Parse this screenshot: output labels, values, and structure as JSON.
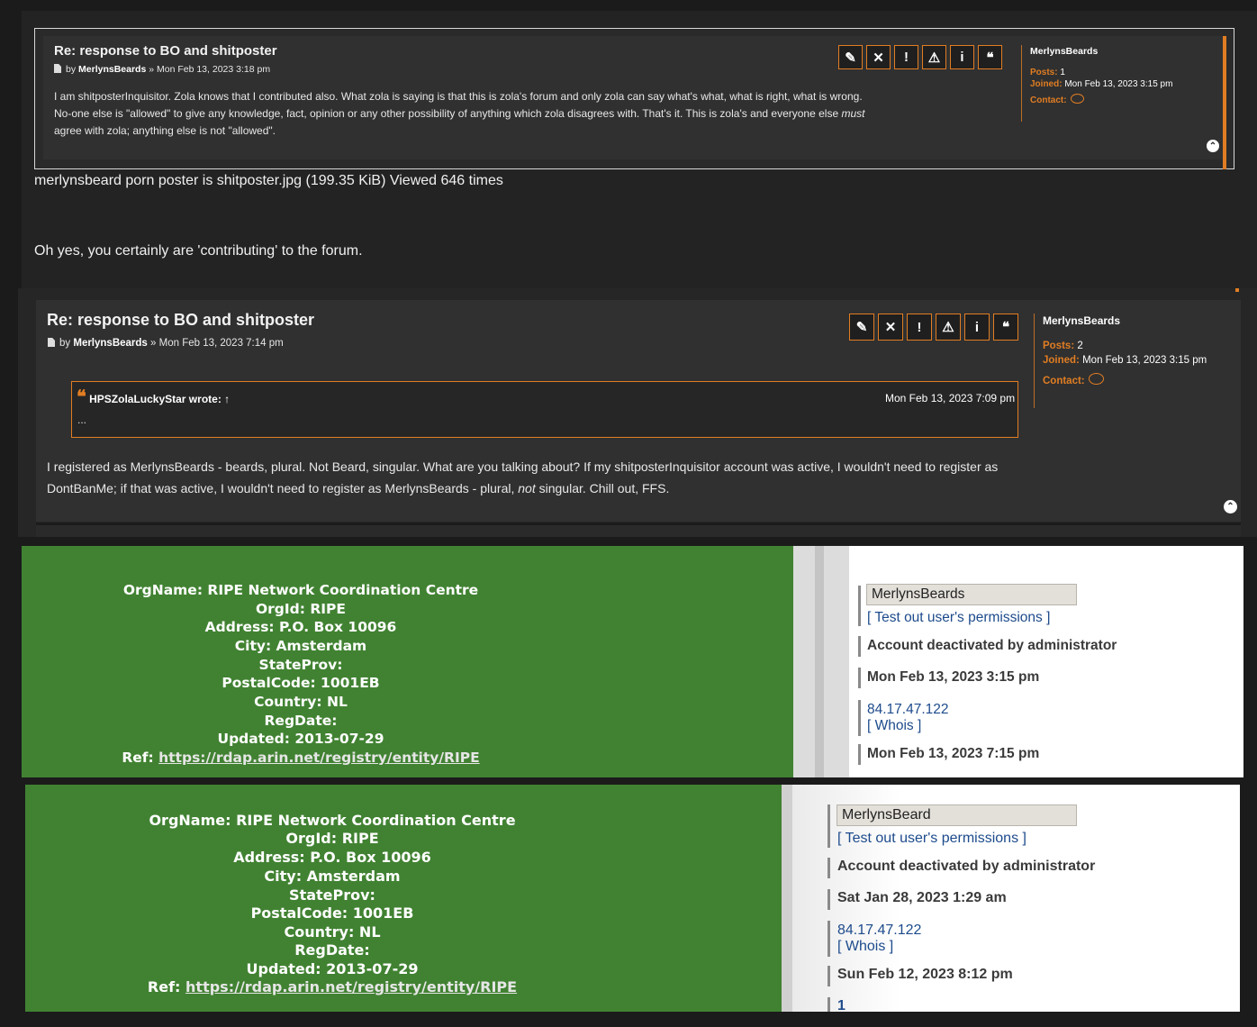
{
  "post1": {
    "title": "Re: response to BO and shitposter",
    "meta_by": "by",
    "author": "MerlynsBeards",
    "meta_date": "» Mon Feb 13, 2023 3:18 pm",
    "body_line1": "I am shitposterInquisitor. Zola knows that I contributed also. What zola is saying is that this is zola's forum and only zola can say what's what, what is right, what is wrong.",
    "body_line2_a": "No-one else is \"allowed\" to give any knowledge, fact, opinion or any other possibility of anything which zola disagrees with. That's it. This is zola's and everyone else ",
    "body_line2_em": "must",
    "body_line3": "agree with zola; anything else is not \"allowed\".",
    "profile": {
      "name": "MerlynsBeards",
      "posts_label": "Posts:",
      "posts_value": "1",
      "joined_label": "Joined:",
      "joined_value": "Mon Feb 13, 2023 3:15 pm",
      "contact_label": "Contact:"
    }
  },
  "buttons": [
    {
      "icon": "pencil-icon",
      "glyph": "✎"
    },
    {
      "icon": "close-icon",
      "glyph": "✕"
    },
    {
      "icon": "exclamation-icon",
      "glyph": "!"
    },
    {
      "icon": "warning-icon",
      "glyph": "⚠"
    },
    {
      "icon": "info-icon",
      "glyph": "i"
    },
    {
      "icon": "quote-icon",
      "glyph": "❝"
    }
  ],
  "attachment_caption": "merlynsbeard porn poster is shitposter.jpg (199.35 KiB) Viewed 646 times",
  "reply_text": "Oh yes, you certainly are 'contributing' to the forum.",
  "post2": {
    "title": "Re: response to BO and shitposter",
    "meta_by": "by",
    "author": "MerlynsBeards",
    "meta_date": "» Mon Feb 13, 2023 7:14 pm",
    "quote_author": "HPSZolaLuckyStar wrote: ↑",
    "quote_date": "Mon Feb 13, 2023 7:09 pm",
    "quote_body": "...",
    "body_line1": "I registered as MerlynsBeards - beards, plural. Not Beard, singular. What are you talking about? If my shitposterInquisitor account was active, I wouldn't need to register as",
    "body_line2_a": "DontBanMe; if that was active, I wouldn't need to register as MerlynsBeards - plural, ",
    "body_line2_em": "not",
    "body_line2_b": " singular. Chill out, FFS.",
    "profile": {
      "name": "MerlynsBeards",
      "posts_label": "Posts:",
      "posts_value": "2",
      "joined_label": "Joined:",
      "joined_value": "Mon Feb 13, 2023 3:15 pm",
      "contact_label": "Contact:"
    }
  },
  "whois1": {
    "lines": [
      "OrgName: RIPE Network Coordination Centre",
      "OrgId: RIPE",
      "Address: P.O. Box 10096",
      "City: Amsterdam",
      "StateProv:",
      "PostalCode: 1001EB",
      "Country: NL",
      "RegDate:",
      "Updated: 2013-07-29"
    ],
    "ref_label": "Ref:",
    "ref_link": "https://rdap.arin.net/registry/entity/RIPE"
  },
  "admin1": {
    "username": "MerlynsBeards",
    "permissions_link": "[ Test out user's permissions ]",
    "status": "Account deactivated by administrator",
    "registered": "Mon Feb 13, 2023 3:15 pm",
    "ip": "84.17.47.122",
    "whois_link": "[ Whois ]",
    "last_active": "Mon Feb 13, 2023 7:15 pm"
  },
  "whois2": {
    "lines": [
      "OrgName: RIPE Network Coordination Centre",
      "OrgId: RIPE",
      "Address: P.O. Box 10096",
      "City: Amsterdam",
      "StateProv:",
      "PostalCode: 1001EB",
      "Country: NL",
      "RegDate:",
      "Updated: 2013-07-29"
    ],
    "ref_label": "Ref:",
    "ref_link": "https://rdap.arin.net/registry/entity/RIPE"
  },
  "admin2": {
    "username": "MerlynsBeard",
    "permissions_link": "[ Test out user's permissions ]",
    "status": "Account deactivated by administrator",
    "registered": "Sat Jan 28, 2023 1:29 am",
    "ip": "84.17.47.122",
    "whois_link": "[ Whois ]",
    "last_active": "Sun Feb 12, 2023 8:12 pm",
    "posts_count": "1"
  },
  "colors": {
    "accent": "#e07d23",
    "whois_green": "#418232",
    "admin_link": "#1d4b8c"
  }
}
